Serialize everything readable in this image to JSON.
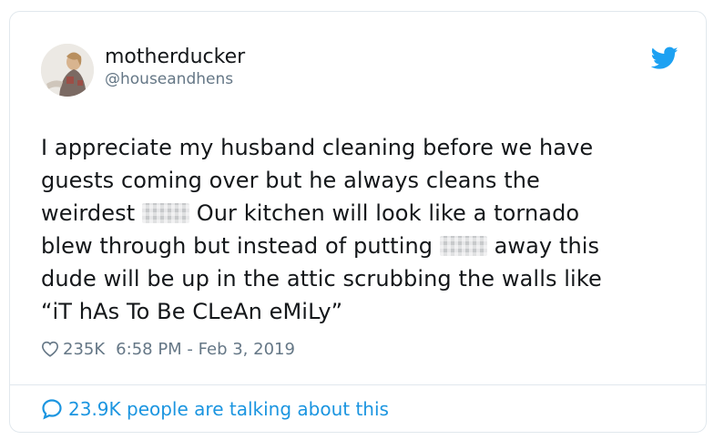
{
  "tweet": {
    "display_name": "motherducker",
    "handle": "@houseandhens",
    "lines": {
      "l1": "I appreciate my husband cleaning before we have",
      "l2": "guests coming over but he always cleans the",
      "l3a": "weirdest",
      "l3b": "Our kitchen will look like a tornado",
      "l4a": "blew through but instead of putting",
      "l4b": "away this",
      "l5": "dude will be up in the attic scrubbing the walls like",
      "l6": "“iT hAs To Be CLeAn eMiLy”"
    },
    "likes": "235K",
    "timestamp": "6:58 PM - Feb 3, 2019",
    "talking": "23.9K people are talking about this",
    "icons": [
      "twitter-bird-icon",
      "heart-icon",
      "comment-bubble-icon"
    ],
    "colors": {
      "brand": "#1da1f2",
      "link": "#1b95e0",
      "muted": "#657786",
      "text": "#14171a",
      "border": "#e1e8ed"
    }
  }
}
